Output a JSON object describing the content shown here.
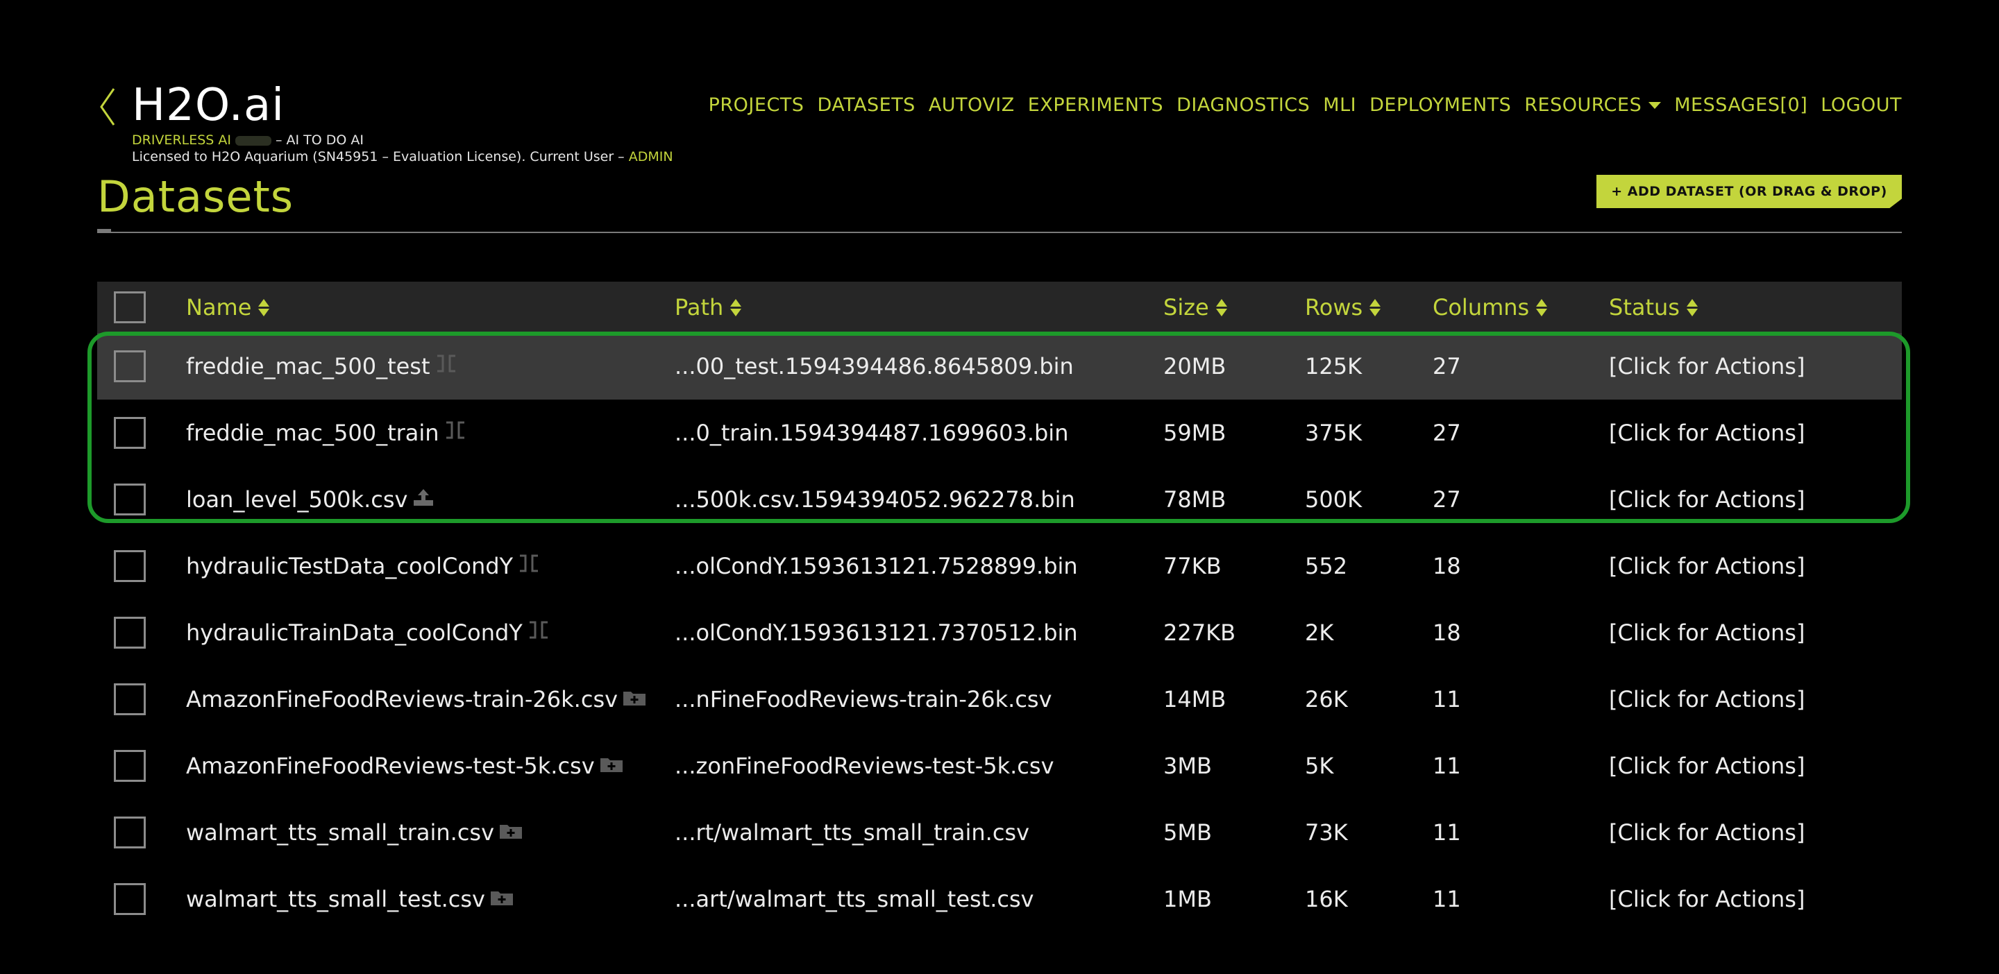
{
  "header": {
    "brand": "H2O.ai",
    "product": "DRIVERLESS AI",
    "tagline": "– AI TO DO AI",
    "license_text": "Licensed to H2O Aquarium (SN45951 – Evaluation License). Current User –",
    "current_user": "ADMIN"
  },
  "nav": {
    "items": [
      "PROJECTS",
      "DATASETS",
      "AUTOVIZ",
      "EXPERIMENTS",
      "DIAGNOSTICS",
      "MLI",
      "DEPLOYMENTS",
      "RESOURCES",
      "MESSAGES[0]",
      "LOGOUT"
    ]
  },
  "page": {
    "title": "Datasets",
    "add_button": "+ ADD DATASET (OR DRAG & DROP)"
  },
  "table": {
    "headers": {
      "name": "Name",
      "path": "Path",
      "size": "Size",
      "rows": "Rows",
      "columns": "Columns",
      "status": "Status"
    },
    "rows": [
      {
        "name": "freddie_mac_500_test",
        "source_icon": "split-icon",
        "path": "...00_test.1594394486.8645809.bin",
        "size": "20MB",
        "rows": "125K",
        "columns": "27",
        "status": "[Click for Actions]"
      },
      {
        "name": "freddie_mac_500_train",
        "source_icon": "split-icon",
        "path": "...0_train.1594394487.1699603.bin",
        "size": "59MB",
        "rows": "375K",
        "columns": "27",
        "status": "[Click for Actions]"
      },
      {
        "name": "loan_level_500k.csv",
        "source_icon": "upload-icon",
        "path": "...500k.csv.1594394052.962278.bin",
        "size": "78MB",
        "rows": "500K",
        "columns": "27",
        "status": "[Click for Actions]"
      },
      {
        "name": "hydraulicTestData_coolCondY",
        "source_icon": "split-icon",
        "path": "...olCondY.1593613121.7528899.bin",
        "size": "77KB",
        "rows": "552",
        "columns": "18",
        "status": "[Click for Actions]"
      },
      {
        "name": "hydraulicTrainData_coolCondY",
        "source_icon": "split-icon",
        "path": "...olCondY.1593613121.7370512.bin",
        "size": "227KB",
        "rows": "2K",
        "columns": "18",
        "status": "[Click for Actions]"
      },
      {
        "name": "AmazonFineFoodReviews-train-26k.csv",
        "source_icon": "folder-icon",
        "path": "...nFineFoodReviews-train-26k.csv",
        "size": "14MB",
        "rows": "26K",
        "columns": "11",
        "status": "[Click for Actions]"
      },
      {
        "name": "AmazonFineFoodReviews-test-5k.csv",
        "source_icon": "folder-icon",
        "path": "...zonFineFoodReviews-test-5k.csv",
        "size": "3MB",
        "rows": "5K",
        "columns": "11",
        "status": "[Click for Actions]"
      },
      {
        "name": "walmart_tts_small_train.csv",
        "source_icon": "folder-icon",
        "path": "...rt/walmart_tts_small_train.csv",
        "size": "5MB",
        "rows": "73K",
        "columns": "11",
        "status": "[Click for Actions]"
      },
      {
        "name": "walmart_tts_small_test.csv",
        "source_icon": "folder-icon",
        "path": "...art/walmart_tts_small_test.csv",
        "size": "1MB",
        "rows": "16K",
        "columns": "11",
        "status": "[Click for Actions]"
      }
    ]
  },
  "colors": {
    "accent": "#c3d53c",
    "background": "#000000",
    "highlight": "#1d9a2a"
  }
}
